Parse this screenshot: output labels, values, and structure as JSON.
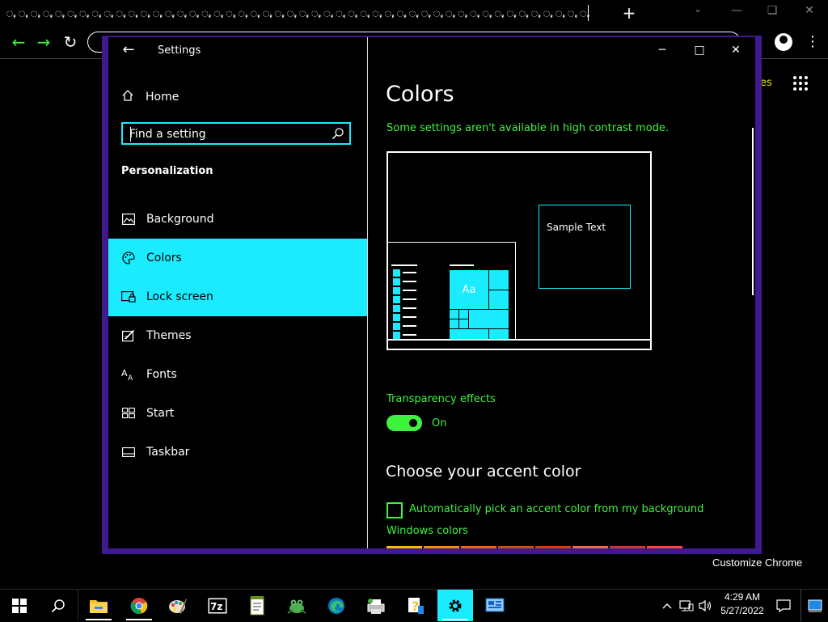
{
  "chrome": {
    "tab_glyph": "ꩻ",
    "tab_count": 48,
    "new_tab_label": "+",
    "apps_partial_text": "es",
    "customize_label": "Customize Chrome"
  },
  "settings": {
    "window_title": "Settings",
    "nav": {
      "home_label": "Home",
      "search_placeholder": "Find a setting",
      "section_label": "Personalization",
      "items": [
        {
          "label": "Background",
          "icon": "picture-icon",
          "selected": false
        },
        {
          "label": "Colors",
          "icon": "palette-icon",
          "selected": true
        },
        {
          "label": "Lock screen",
          "icon": "lock-screen-icon",
          "selected": true
        },
        {
          "label": "Themes",
          "icon": "themes-icon",
          "selected": false
        },
        {
          "label": "Fonts",
          "icon": "fonts-icon",
          "selected": false
        },
        {
          "label": "Start",
          "icon": "start-icon",
          "selected": false
        },
        {
          "label": "Taskbar",
          "icon": "taskbar-icon",
          "selected": false
        }
      ]
    },
    "pane": {
      "title": "Colors",
      "hc_notice": "Some settings aren't available in high contrast mode.",
      "preview": {
        "sample_text": "Sample Text",
        "tile_text": "Aa"
      },
      "transparency": {
        "label": "Transparency effects",
        "state": "On",
        "enabled": true
      },
      "accent_heading": "Choose your accent color",
      "auto_pick_label": "Automatically pick an accent color from my background",
      "auto_pick_checked": false,
      "windows_colors_label": "Windows colors"
    }
  },
  "taskbar": {
    "apps": [
      "file-explorer-icon",
      "chrome-icon",
      "paint-icon",
      "7zip-icon",
      "notepad-icon",
      "frog-icon",
      "edge-icon",
      "printer-icon",
      "help-icon",
      "settings-icon",
      "desktop-app-icon"
    ],
    "active_app": "settings-icon",
    "time": "4:29 AM",
    "date": "5/27/2022"
  },
  "colors": {
    "accent": "#1aebff",
    "highlight_text": "#3ff23f",
    "window_border": "#3f1a8f",
    "swatches": [
      "#ffb900",
      "#ff8c00",
      "#f7630c",
      "#ca5010",
      "#da3b01",
      "#ef6950",
      "#d13438",
      "#ff4343"
    ]
  }
}
